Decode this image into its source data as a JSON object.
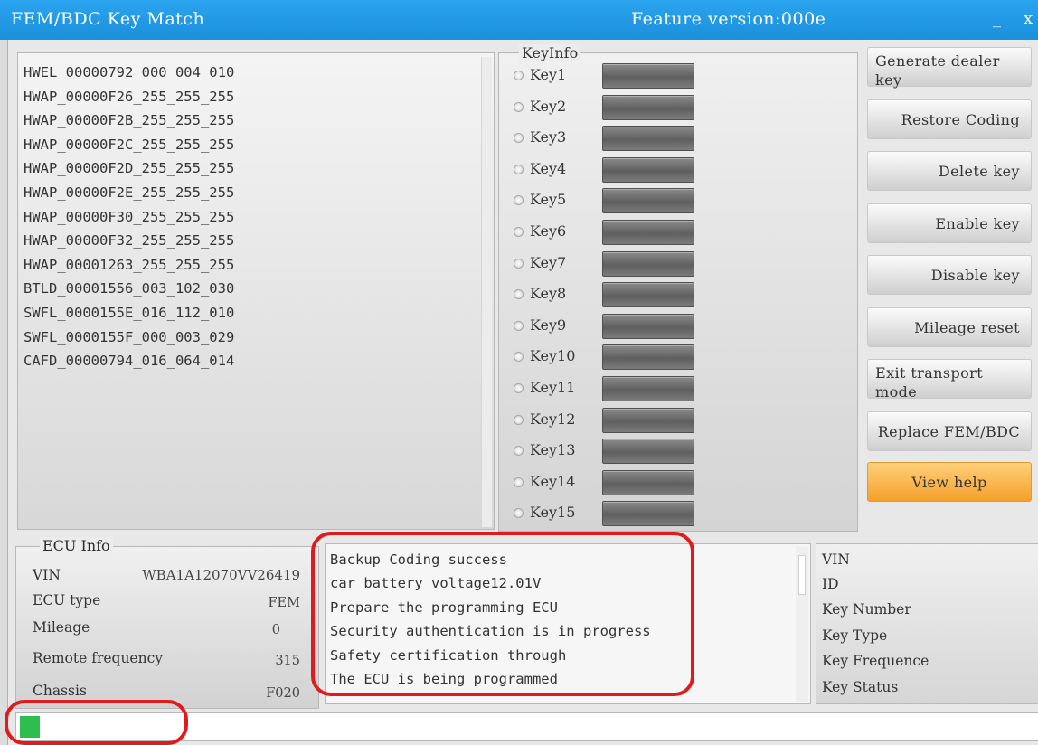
{
  "window": {
    "title": "FEM/BDC Key Match",
    "feature_version": "Feature version:000e",
    "minimize_symbol": "_",
    "close_symbol": "x"
  },
  "file_list": [
    "HWEL_00000792_000_004_010",
    "HWAP_00000F26_255_255_255",
    "HWAP_00000F2B_255_255_255",
    "HWAP_00000F2C_255_255_255",
    "HWAP_00000F2D_255_255_255",
    "HWAP_00000F2E_255_255_255",
    "HWAP_00000F30_255_255_255",
    "HWAP_00000F32_255_255_255",
    "HWAP_00001263_255_255_255",
    "BTLD_00001556_003_102_030",
    "SWFL_0000155E_016_112_010",
    "SWFL_0000155F_000_003_029",
    "CAFD_00000794_016_064_014"
  ],
  "key_info": {
    "title": "KeyInfo",
    "keys": [
      "Key1",
      "Key2",
      "Key3",
      "Key4",
      "Key5",
      "Key6",
      "Key7",
      "Key8",
      "Key9",
      "Key10",
      "Key11",
      "Key12",
      "Key13",
      "Key14",
      "Key15"
    ]
  },
  "buttons": {
    "generate_dealer_key": "Generate dealer key",
    "restore_coding": "Restore Coding",
    "delete_key": "Delete key",
    "enable_key": "Enable key",
    "disable_key": "Disable key",
    "mileage_reset": "Mileage reset",
    "exit_transport_mode": "Exit transport mode",
    "replace_fem_bdc": "Replace FEM/BDC",
    "view_help": "View help"
  },
  "ecu_info": {
    "title": "ECU Info",
    "vin_label": "VIN",
    "vin_value": "WBA1A12070VV26419",
    "ecu_type_label": "ECU type",
    "ecu_type_value": "FEM",
    "mileage_label": "Mileage",
    "mileage_value": "0",
    "remote_frequency_label": "Remote frequency",
    "remote_frequency_value": "315",
    "chassis_label": "Chassis",
    "chassis_value": "F020"
  },
  "log": [
    "Backup Coding success",
    "car battery voltage12.01V",
    "Prepare the programming ECU",
    "Security authentication is in progress",
    "Safety certification through",
    "The ECU is being programmed"
  ],
  "key_detail": {
    "vin": "VIN",
    "id": "ID",
    "key_number": "Key Number",
    "key_type": "Key Type",
    "key_frequence": "Key Frequence",
    "key_status": "Key Status"
  },
  "progress": {
    "value_fraction": 0.02,
    "color": "#2ebd4f"
  },
  "annotation_color": "#e01b1b"
}
